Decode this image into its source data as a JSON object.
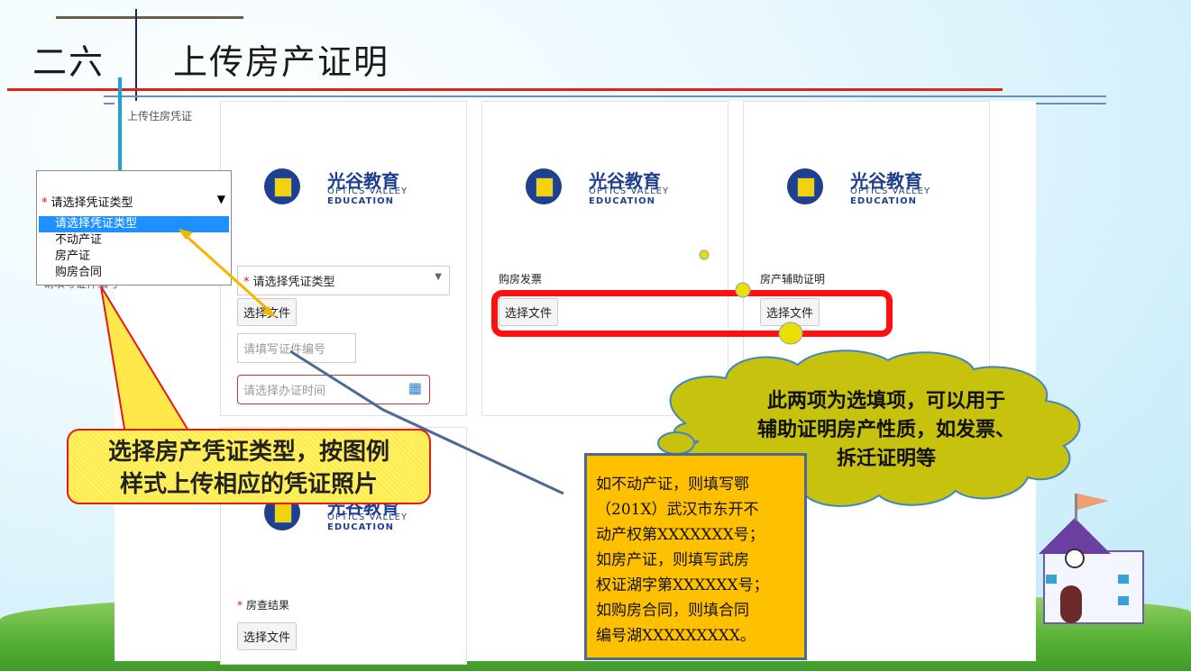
{
  "slide": {
    "section_number": "二六",
    "section_title": "上传房产证明"
  },
  "screen": {
    "top_label": "上传住房凭证",
    "cards": {
      "first": {
        "logo": {
          "cn": "光谷教育",
          "en1": "OPTICS VALLEY",
          "en2": "EDUCATION"
        },
        "type_select": "请选择凭证类型",
        "choose_file": "选择文件",
        "cert_number_placeholder": "请填写证件编号",
        "cert_date_placeholder": "请选择办证时间"
      },
      "invoice": {
        "logo": {
          "cn": "光谷教育",
          "en1": "OPTICS VALLEY",
          "en2": "EDUCATION"
        },
        "label": "购房发票",
        "choose_file": "选择文件"
      },
      "aux": {
        "logo": {
          "cn": "光谷教育",
          "en1": "OPTICS VALLEY",
          "en2": "EDUCATION"
        },
        "label": "房产辅助证明",
        "choose_file": "选择文件"
      },
      "bottom": {
        "logo": {
          "cn": "光谷教育",
          "en1": "OPTICS VALLEY",
          "en2": "EDUCATION"
        },
        "label": "房查结果",
        "choose_file": "选择文件"
      }
    },
    "hidden_label": "请填写证件编号"
  },
  "dropdown": {
    "current": "请选择凭证类型",
    "options": [
      "请选择凭证类型",
      "不动产证",
      "房产证",
      "购房合同"
    ]
  },
  "callouts": {
    "yellow_line1": "选择房产凭证类型，按图例",
    "yellow_line2": "样式上传相应的凭证照片",
    "cloud_line1": "此两项为选填项，可以用于",
    "cloud_line2": "辅助证明房产性质，如发票、",
    "cloud_line3": "拆迁证明等",
    "orange_lines": [
      "如不动产证，则填写鄂",
      "（201X）武汉市东开不",
      "动产权第XXXXXXX号；",
      "如房产证，则填写武房",
      "权证湖字第XXXXXX号；",
      "如购房合同，则填合同",
      "编号湖XXXXXXXXX。"
    ]
  },
  "colors": {
    "red": "#e0241b",
    "accent_blue": "#1e90ff",
    "orange": "#ffc000",
    "cloud": "#c6c10b"
  }
}
